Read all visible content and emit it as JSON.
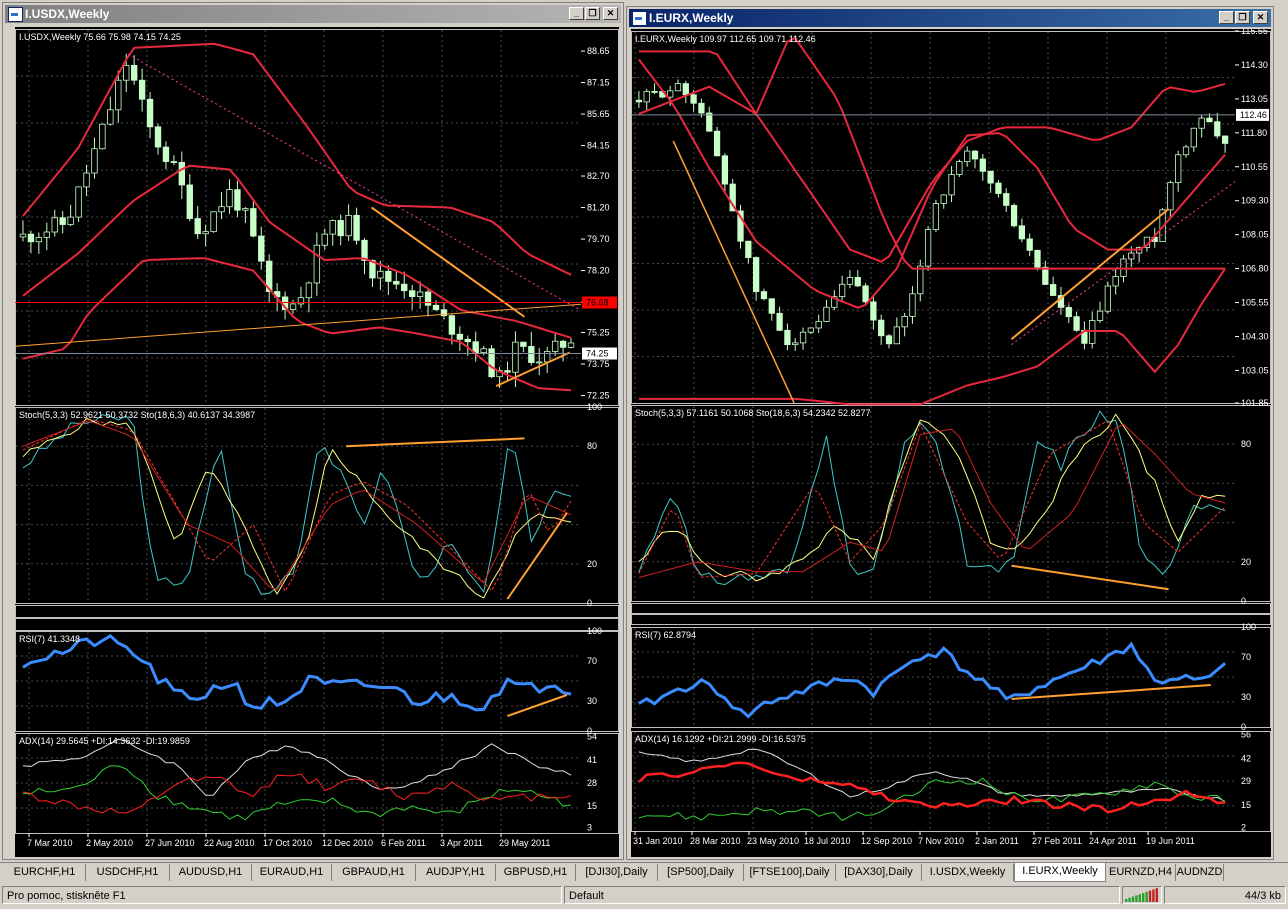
{
  "windows": [
    {
      "title": "I.USDX,Weekly",
      "active": false,
      "header": "I.USDX,Weekly  75.66 75.98 74.15 74.25",
      "price_scale": [
        "88.65",
        "87.15",
        "85.65",
        "84.15",
        "82.70",
        "81.20",
        "79.70",
        "78.20",
        "76.70",
        "75.25",
        "73.75",
        "72.25"
      ],
      "markers": [
        {
          "label": "76.68",
          "value": 76.68,
          "color": "#ff0000"
        },
        {
          "label": "74.25",
          "value": 74.25,
          "color": "#ffffff"
        }
      ],
      "dates": [
        "7 Mar 2010",
        "2 May 2010",
        "27 Jun 2010",
        "22 Aug 2010",
        "17 Oct 2010",
        "12 Dec 2010",
        "6 Feb 2011",
        "3 Apr 2011",
        "29 May 2011"
      ],
      "stoch": {
        "label": "Stoch(5,3,3) 52.9621 50.3732  Sto(18,6,3) 40.6137 34.3987",
        "scale": [
          "100",
          "80",
          "20",
          "0"
        ]
      },
      "rsi": {
        "label": "RSI(7) 41.3348",
        "scale": [
          "100",
          "70",
          "30",
          "0"
        ]
      },
      "adx": {
        "label": "ADX(14) 29.5645 +DI:14.3632 -DI:19.9859",
        "scale": [
          "54",
          "41",
          "28",
          "15",
          "3"
        ]
      }
    },
    {
      "title": "I.EURX,Weekly",
      "active": true,
      "header": "I.EURX,Weekly  109.97 112.65 109.71 112.46",
      "price_scale": [
        "115.55",
        "114.30",
        "113.05",
        "111.80",
        "110.55",
        "109.30",
        "108.05",
        "106.80",
        "105.55",
        "104.30",
        "103.05",
        "101.85"
      ],
      "markers": [
        {
          "label": "112.46",
          "value": 112.46,
          "color": "#ffffff"
        }
      ],
      "dates": [
        "31 Jan 2010",
        "28 Mar 2010",
        "23 May 2010",
        "18 Jul 2010",
        "12 Sep 2010",
        "7 Nov 2010",
        "2 Jan 2011",
        "27 Feb 2011",
        "24 Apr 2011",
        "19 Jun 2011"
      ],
      "stoch": {
        "label": "Stoch(5,3,3) 57.1161 50.1068  Sto(18,6,3) 54.2342 52.8277",
        "scale": [
          "80",
          "20",
          "0"
        ]
      },
      "rsi": {
        "label": "RSI(7) 62.8794",
        "scale": [
          "100",
          "70",
          "30",
          "0"
        ]
      },
      "adx": {
        "label": "ADX(14) 16.1292 +DI:21.2999 -DI:16.5375",
        "scale": [
          "56",
          "42",
          "29",
          "15",
          "2"
        ]
      }
    }
  ],
  "tabs": [
    "EURCHF,H1",
    "USDCHF,H1",
    "AUDUSD,H1",
    "EURAUD,H1",
    "GBPAUD,H1",
    "AUDJPY,H1",
    "GBPUSD,H1",
    "[DJI30],Daily",
    "[SP500],Daily",
    "[FTSE100],Daily",
    "[DAX30],Daily",
    "I.USDX,Weekly",
    "I.EURX,Weekly",
    "EURNZD,H4",
    "AUDNZD"
  ],
  "active_tab": "I.EURX,Weekly",
  "status": {
    "help": "Pro pomoc, stiskněte F1",
    "profile": "Default",
    "traffic": "44/3 kb"
  },
  "colors": {
    "bg": "#000000",
    "grid": "#4a4a4a",
    "bull": "#c8ffc8",
    "bear": "#c8ffc8",
    "band": "#e8283c",
    "trend": "#ffa030",
    "rsi": "#3a8cff",
    "stoch_main": "#ffff80",
    "stoch_sig": "#ff3030",
    "stoch_slow": "#40c8c8",
    "adx": "#e0e0e0",
    "plus_di": "#30d030",
    "minus_di": "#ff2020"
  },
  "icons": [
    "chart-window-icon",
    "minimize-icon",
    "restore-icon",
    "close-icon",
    "connection-bars-icon"
  ]
}
